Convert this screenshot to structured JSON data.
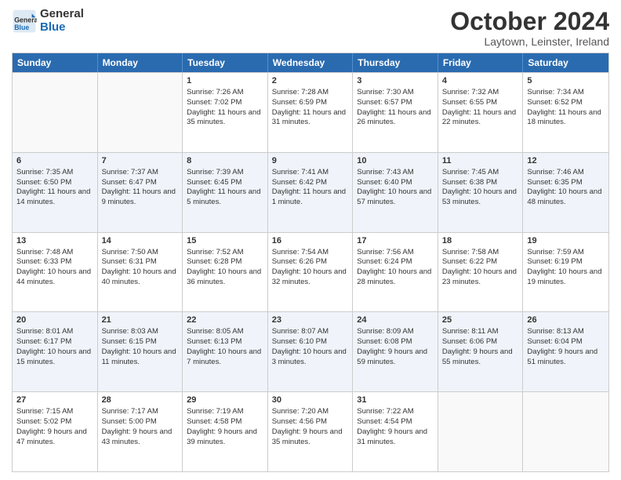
{
  "logo": {
    "line1": "General",
    "line2": "Blue"
  },
  "title": "October 2024",
  "subtitle": "Laytown, Leinster, Ireland",
  "header_days": [
    "Sunday",
    "Monday",
    "Tuesday",
    "Wednesday",
    "Thursday",
    "Friday",
    "Saturday"
  ],
  "weeks": [
    [
      {
        "day": "",
        "sunrise": "",
        "sunset": "",
        "daylight": ""
      },
      {
        "day": "",
        "sunrise": "",
        "sunset": "",
        "daylight": ""
      },
      {
        "day": "1",
        "sunrise": "Sunrise: 7:26 AM",
        "sunset": "Sunset: 7:02 PM",
        "daylight": "Daylight: 11 hours and 35 minutes."
      },
      {
        "day": "2",
        "sunrise": "Sunrise: 7:28 AM",
        "sunset": "Sunset: 6:59 PM",
        "daylight": "Daylight: 11 hours and 31 minutes."
      },
      {
        "day": "3",
        "sunrise": "Sunrise: 7:30 AM",
        "sunset": "Sunset: 6:57 PM",
        "daylight": "Daylight: 11 hours and 26 minutes."
      },
      {
        "day": "4",
        "sunrise": "Sunrise: 7:32 AM",
        "sunset": "Sunset: 6:55 PM",
        "daylight": "Daylight: 11 hours and 22 minutes."
      },
      {
        "day": "5",
        "sunrise": "Sunrise: 7:34 AM",
        "sunset": "Sunset: 6:52 PM",
        "daylight": "Daylight: 11 hours and 18 minutes."
      }
    ],
    [
      {
        "day": "6",
        "sunrise": "Sunrise: 7:35 AM",
        "sunset": "Sunset: 6:50 PM",
        "daylight": "Daylight: 11 hours and 14 minutes."
      },
      {
        "day": "7",
        "sunrise": "Sunrise: 7:37 AM",
        "sunset": "Sunset: 6:47 PM",
        "daylight": "Daylight: 11 hours and 9 minutes."
      },
      {
        "day": "8",
        "sunrise": "Sunrise: 7:39 AM",
        "sunset": "Sunset: 6:45 PM",
        "daylight": "Daylight: 11 hours and 5 minutes."
      },
      {
        "day": "9",
        "sunrise": "Sunrise: 7:41 AM",
        "sunset": "Sunset: 6:42 PM",
        "daylight": "Daylight: 11 hours and 1 minute."
      },
      {
        "day": "10",
        "sunrise": "Sunrise: 7:43 AM",
        "sunset": "Sunset: 6:40 PM",
        "daylight": "Daylight: 10 hours and 57 minutes."
      },
      {
        "day": "11",
        "sunrise": "Sunrise: 7:45 AM",
        "sunset": "Sunset: 6:38 PM",
        "daylight": "Daylight: 10 hours and 53 minutes."
      },
      {
        "day": "12",
        "sunrise": "Sunrise: 7:46 AM",
        "sunset": "Sunset: 6:35 PM",
        "daylight": "Daylight: 10 hours and 48 minutes."
      }
    ],
    [
      {
        "day": "13",
        "sunrise": "Sunrise: 7:48 AM",
        "sunset": "Sunset: 6:33 PM",
        "daylight": "Daylight: 10 hours and 44 minutes."
      },
      {
        "day": "14",
        "sunrise": "Sunrise: 7:50 AM",
        "sunset": "Sunset: 6:31 PM",
        "daylight": "Daylight: 10 hours and 40 minutes."
      },
      {
        "day": "15",
        "sunrise": "Sunrise: 7:52 AM",
        "sunset": "Sunset: 6:28 PM",
        "daylight": "Daylight: 10 hours and 36 minutes."
      },
      {
        "day": "16",
        "sunrise": "Sunrise: 7:54 AM",
        "sunset": "Sunset: 6:26 PM",
        "daylight": "Daylight: 10 hours and 32 minutes."
      },
      {
        "day": "17",
        "sunrise": "Sunrise: 7:56 AM",
        "sunset": "Sunset: 6:24 PM",
        "daylight": "Daylight: 10 hours and 28 minutes."
      },
      {
        "day": "18",
        "sunrise": "Sunrise: 7:58 AM",
        "sunset": "Sunset: 6:22 PM",
        "daylight": "Daylight: 10 hours and 23 minutes."
      },
      {
        "day": "19",
        "sunrise": "Sunrise: 7:59 AM",
        "sunset": "Sunset: 6:19 PM",
        "daylight": "Daylight: 10 hours and 19 minutes."
      }
    ],
    [
      {
        "day": "20",
        "sunrise": "Sunrise: 8:01 AM",
        "sunset": "Sunset: 6:17 PM",
        "daylight": "Daylight: 10 hours and 15 minutes."
      },
      {
        "day": "21",
        "sunrise": "Sunrise: 8:03 AM",
        "sunset": "Sunset: 6:15 PM",
        "daylight": "Daylight: 10 hours and 11 minutes."
      },
      {
        "day": "22",
        "sunrise": "Sunrise: 8:05 AM",
        "sunset": "Sunset: 6:13 PM",
        "daylight": "Daylight: 10 hours and 7 minutes."
      },
      {
        "day": "23",
        "sunrise": "Sunrise: 8:07 AM",
        "sunset": "Sunset: 6:10 PM",
        "daylight": "Daylight: 10 hours and 3 minutes."
      },
      {
        "day": "24",
        "sunrise": "Sunrise: 8:09 AM",
        "sunset": "Sunset: 6:08 PM",
        "daylight": "Daylight: 9 hours and 59 minutes."
      },
      {
        "day": "25",
        "sunrise": "Sunrise: 8:11 AM",
        "sunset": "Sunset: 6:06 PM",
        "daylight": "Daylight: 9 hours and 55 minutes."
      },
      {
        "day": "26",
        "sunrise": "Sunrise: 8:13 AM",
        "sunset": "Sunset: 6:04 PM",
        "daylight": "Daylight: 9 hours and 51 minutes."
      }
    ],
    [
      {
        "day": "27",
        "sunrise": "Sunrise: 7:15 AM",
        "sunset": "Sunset: 5:02 PM",
        "daylight": "Daylight: 9 hours and 47 minutes."
      },
      {
        "day": "28",
        "sunrise": "Sunrise: 7:17 AM",
        "sunset": "Sunset: 5:00 PM",
        "daylight": "Daylight: 9 hours and 43 minutes."
      },
      {
        "day": "29",
        "sunrise": "Sunrise: 7:19 AM",
        "sunset": "Sunset: 4:58 PM",
        "daylight": "Daylight: 9 hours and 39 minutes."
      },
      {
        "day": "30",
        "sunrise": "Sunrise: 7:20 AM",
        "sunset": "Sunset: 4:56 PM",
        "daylight": "Daylight: 9 hours and 35 minutes."
      },
      {
        "day": "31",
        "sunrise": "Sunrise: 7:22 AM",
        "sunset": "Sunset: 4:54 PM",
        "daylight": "Daylight: 9 hours and 31 minutes."
      },
      {
        "day": "",
        "sunrise": "",
        "sunset": "",
        "daylight": ""
      },
      {
        "day": "",
        "sunrise": "",
        "sunset": "",
        "daylight": ""
      }
    ]
  ]
}
